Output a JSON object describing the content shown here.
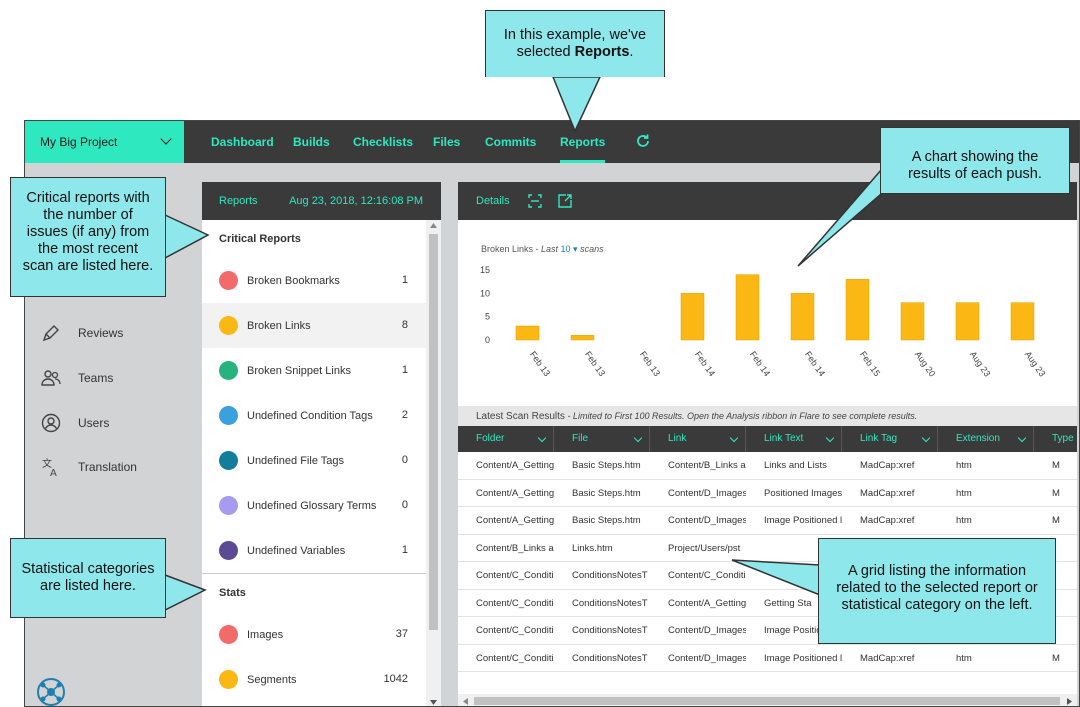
{
  "project": {
    "name": "My Big Project"
  },
  "nav": [
    {
      "label": "Dashboard",
      "active": false
    },
    {
      "label": "Builds",
      "active": false
    },
    {
      "label": "Checklists",
      "active": false
    },
    {
      "label": "Files",
      "active": false
    },
    {
      "label": "Commits",
      "active": false
    },
    {
      "label": "Reports",
      "active": true
    }
  ],
  "sidebar": {
    "items": [
      {
        "label": "Reviews",
        "icon": "pen-icon"
      },
      {
        "label": "Teams",
        "icon": "teams-icon"
      },
      {
        "label": "Users",
        "icon": "user-icon"
      },
      {
        "label": "Translation",
        "icon": "translation-icon"
      }
    ]
  },
  "reports_panel": {
    "title": "Reports",
    "date": "Aug 23, 2018, 12:16:08 PM",
    "critical_title": "Critical Reports",
    "critical": [
      {
        "label": "Broken Bookmarks",
        "count": "1",
        "color": "#f26b6b"
      },
      {
        "label": "Broken Links",
        "count": "8",
        "color": "#fbb714"
      },
      {
        "label": "Broken Snippet Links",
        "count": "1",
        "color": "#27b37e"
      },
      {
        "label": "Undefined Condition Tags",
        "count": "2",
        "color": "#3aa0de"
      },
      {
        "label": "Undefined File Tags",
        "count": "0",
        "color": "#137e9c"
      },
      {
        "label": "Undefined Glossary Terms",
        "count": "0",
        "color": "#a69bf0"
      },
      {
        "label": "Undefined Variables",
        "count": "1",
        "color": "#5d4a94"
      }
    ],
    "stats_title": "Stats",
    "stats": [
      {
        "label": "Images",
        "count": "37",
        "color": "#f26b6b"
      },
      {
        "label": "Segments",
        "count": "1042",
        "color": "#fbb714"
      }
    ]
  },
  "details_panel": {
    "title": "Details"
  },
  "chart_data": {
    "type": "bar",
    "title_prefix": "Broken Links - ",
    "title_italic": "Last",
    "last_count": "10",
    "title_suffix": "scans",
    "categories": [
      "Feb 13",
      "Feb 13",
      "Feb 13",
      "Feb 14",
      "Feb 14",
      "Feb 14",
      "Feb 15",
      "Aug 20",
      "Aug 23",
      "Aug 23"
    ],
    "values": [
      3,
      1,
      0,
      10,
      14,
      10,
      13,
      8,
      8,
      8
    ],
    "yticks": [
      "0",
      "5",
      "10",
      "15"
    ],
    "ylim": [
      0,
      15
    ],
    "bar_color": "#fbb714",
    "grid": false
  },
  "scan_results": {
    "title": "Latest Scan Results",
    "note": " - Limited to First 100 Results. Open the Analysis ribbon in Flare to see complete results."
  },
  "grid": {
    "columns": [
      "Folder",
      "File",
      "Link",
      "Link Text",
      "Link Tag",
      "Extension",
      "Type"
    ],
    "rows": [
      [
        "Content/A_Getting",
        "Basic Steps.htm",
        "Content/B_Links a",
        "Links and Lists",
        "MadCap:xref",
        "htm",
        "M"
      ],
      [
        "Content/A_Getting",
        "Basic Steps.htm",
        "Content/D_Images",
        "Positioned Images",
        "MadCap:xref",
        "htm",
        "M"
      ],
      [
        "Content/A_Getting",
        "Basic Steps.htm",
        "Content/D_Images",
        "Image Positioned l",
        "MadCap:xref",
        "htm",
        "M"
      ],
      [
        "Content/B_Links a",
        "Links.htm",
        "Project/Users/pst",
        "",
        "",
        "",
        ""
      ],
      [
        "Content/C_Conditi",
        "ConditionsNotesT",
        "Content/C_Conditi",
        "",
        "",
        "",
        ""
      ],
      [
        "Content/C_Conditi",
        "ConditionsNotesT",
        "Content/A_Getting",
        "Getting Sta",
        "",
        "",
        ""
      ],
      [
        "Content/C_Conditi",
        "ConditionsNotesT",
        "Content/D_Images",
        "Image Positio",
        "",
        "",
        ""
      ],
      [
        "Content/C_Conditi",
        "ConditionsNotesT",
        "Content/D_Images",
        "Image Positioned l",
        "MadCap:xref",
        "htm",
        "M"
      ]
    ]
  },
  "callouts": {
    "reports_line1": "In this example, we've",
    "reports_line2_prefix": "selected ",
    "reports_line2_bold": "Reports",
    "reports_line2_suffix": ".",
    "chart": [
      "A chart showing the",
      "results of each push."
    ],
    "critical": [
      "Critical reports with",
      "the number of",
      "issues (if any) from",
      "the most recent",
      "scan are listed here."
    ],
    "stats": [
      "Statistical categories",
      "are listed here."
    ],
    "grid": [
      "A grid listing the information",
      "related to the selected report or",
      "statistical category on the left."
    ]
  }
}
